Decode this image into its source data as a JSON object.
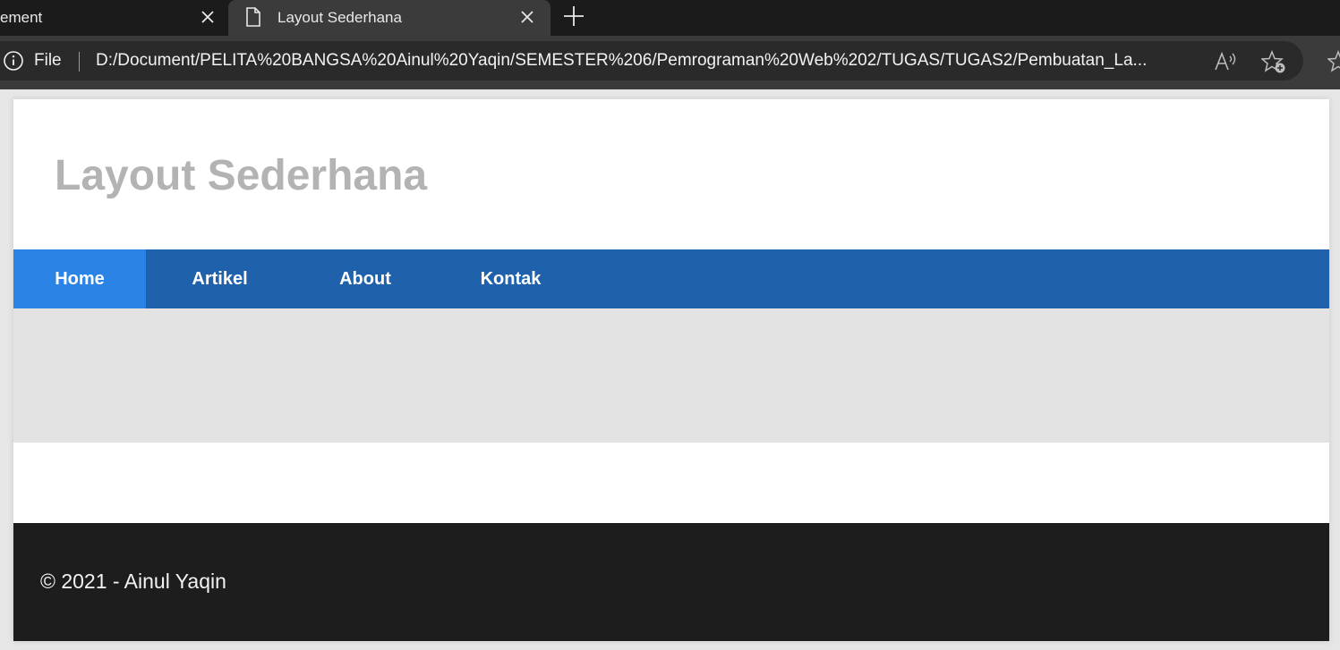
{
  "browser": {
    "tabs": [
      {
        "title": "ement",
        "active": false
      },
      {
        "title": "Layout Sederhana",
        "active": true
      }
    ],
    "file_label": "File",
    "url": "D:/Document/PELITA%20BANGSA%20Ainul%20Yaqin/SEMESTER%206/Pemrograman%20Web%202/TUGAS/TUGAS2/Pembuatan_La..."
  },
  "page": {
    "title": "Layout Sederhana",
    "nav": [
      {
        "label": "Home",
        "active": true
      },
      {
        "label": "Artikel",
        "active": false
      },
      {
        "label": "About",
        "active": false
      },
      {
        "label": "Kontak",
        "active": false
      }
    ],
    "footer": "© 2021 - Ainul Yaqin"
  },
  "colors": {
    "nav_bg": "#2061ab",
    "nav_active": "#2b84e5",
    "title": "#b3b3b3",
    "banner": "#e3e3e3",
    "footer_bg": "#1d1d1d"
  }
}
